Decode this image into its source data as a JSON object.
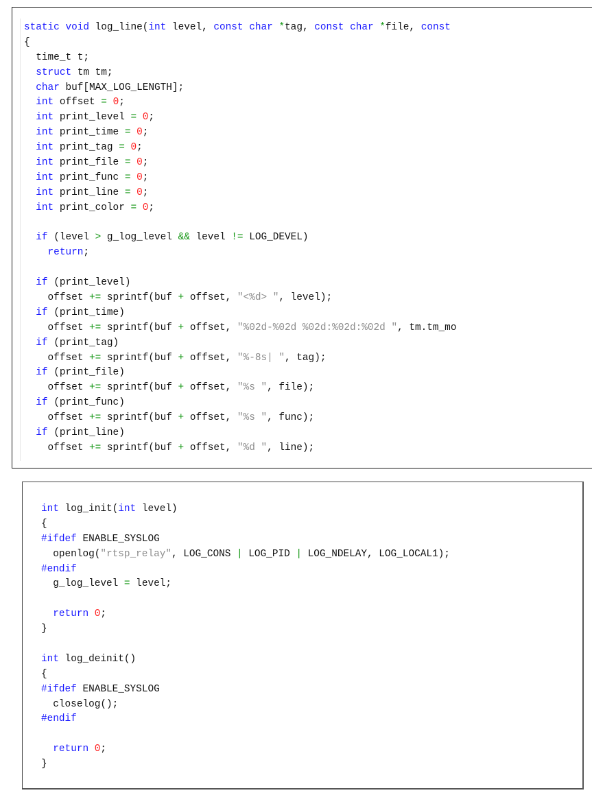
{
  "panels": [
    {
      "name": "log-line-function",
      "lines": [
        [
          [
            "kw",
            "static"
          ],
          [
            "plain",
            " "
          ],
          [
            "kw",
            "void"
          ],
          [
            "plain",
            " log_line("
          ],
          [
            "kw",
            "int"
          ],
          [
            "plain",
            " level, "
          ],
          [
            "kw",
            "const"
          ],
          [
            "plain",
            " "
          ],
          [
            "kw",
            "char"
          ],
          [
            "plain",
            " "
          ],
          [
            "op",
            "*"
          ],
          [
            "plain",
            "tag, "
          ],
          [
            "kw",
            "const"
          ],
          [
            "plain",
            " "
          ],
          [
            "kw",
            "char"
          ],
          [
            "plain",
            " "
          ],
          [
            "op",
            "*"
          ],
          [
            "plain",
            "file, "
          ],
          [
            "kw",
            "const"
          ]
        ],
        [
          [
            "plain",
            "{"
          ]
        ],
        [
          [
            "plain",
            "  time_t t;"
          ]
        ],
        [
          [
            "plain",
            "  "
          ],
          [
            "kw",
            "struct"
          ],
          [
            "plain",
            " tm tm;"
          ]
        ],
        [
          [
            "plain",
            "  "
          ],
          [
            "kw",
            "char"
          ],
          [
            "plain",
            " buf[MAX_LOG_LENGTH];"
          ]
        ],
        [
          [
            "plain",
            "  "
          ],
          [
            "kw",
            "int"
          ],
          [
            "plain",
            " offset "
          ],
          [
            "op",
            "="
          ],
          [
            "plain",
            " "
          ],
          [
            "num",
            "0"
          ],
          [
            "plain",
            ";"
          ]
        ],
        [
          [
            "plain",
            "  "
          ],
          [
            "kw",
            "int"
          ],
          [
            "plain",
            " print_level "
          ],
          [
            "op",
            "="
          ],
          [
            "plain",
            " "
          ],
          [
            "num",
            "0"
          ],
          [
            "plain",
            ";"
          ]
        ],
        [
          [
            "plain",
            "  "
          ],
          [
            "kw",
            "int"
          ],
          [
            "plain",
            " print_time "
          ],
          [
            "op",
            "="
          ],
          [
            "plain",
            " "
          ],
          [
            "num",
            "0"
          ],
          [
            "plain",
            ";"
          ]
        ],
        [
          [
            "plain",
            "  "
          ],
          [
            "kw",
            "int"
          ],
          [
            "plain",
            " print_tag "
          ],
          [
            "op",
            "="
          ],
          [
            "plain",
            " "
          ],
          [
            "num",
            "0"
          ],
          [
            "plain",
            ";"
          ]
        ],
        [
          [
            "plain",
            "  "
          ],
          [
            "kw",
            "int"
          ],
          [
            "plain",
            " print_file "
          ],
          [
            "op",
            "="
          ],
          [
            "plain",
            " "
          ],
          [
            "num",
            "0"
          ],
          [
            "plain",
            ";"
          ]
        ],
        [
          [
            "plain",
            "  "
          ],
          [
            "kw",
            "int"
          ],
          [
            "plain",
            " print_func "
          ],
          [
            "op",
            "="
          ],
          [
            "plain",
            " "
          ],
          [
            "num",
            "0"
          ],
          [
            "plain",
            ";"
          ]
        ],
        [
          [
            "plain",
            "  "
          ],
          [
            "kw",
            "int"
          ],
          [
            "plain",
            " print_line "
          ],
          [
            "op",
            "="
          ],
          [
            "plain",
            " "
          ],
          [
            "num",
            "0"
          ],
          [
            "plain",
            ";"
          ]
        ],
        [
          [
            "plain",
            "  "
          ],
          [
            "kw",
            "int"
          ],
          [
            "plain",
            " print_color "
          ],
          [
            "op",
            "="
          ],
          [
            "plain",
            " "
          ],
          [
            "num",
            "0"
          ],
          [
            "plain",
            ";"
          ]
        ],
        [
          [
            "plain",
            ""
          ]
        ],
        [
          [
            "plain",
            "  "
          ],
          [
            "kw",
            "if"
          ],
          [
            "plain",
            " (level "
          ],
          [
            "op",
            ">"
          ],
          [
            "plain",
            " g_log_level "
          ],
          [
            "op",
            "&&"
          ],
          [
            "plain",
            " level "
          ],
          [
            "op",
            "!="
          ],
          [
            "plain",
            " LOG_DEVEL)"
          ]
        ],
        [
          [
            "plain",
            "    "
          ],
          [
            "kw",
            "return"
          ],
          [
            "plain",
            ";"
          ]
        ],
        [
          [
            "plain",
            ""
          ]
        ],
        [
          [
            "plain",
            "  "
          ],
          [
            "kw",
            "if"
          ],
          [
            "plain",
            " (print_level)"
          ]
        ],
        [
          [
            "plain",
            "    offset "
          ],
          [
            "op",
            "+="
          ],
          [
            "plain",
            " sprintf(buf "
          ],
          [
            "op",
            "+"
          ],
          [
            "plain",
            " offset, "
          ],
          [
            "str",
            "\"<%d> \""
          ],
          [
            "plain",
            ", level);"
          ]
        ],
        [
          [
            "plain",
            "  "
          ],
          [
            "kw",
            "if"
          ],
          [
            "plain",
            " (print_time)"
          ]
        ],
        [
          [
            "plain",
            "    offset "
          ],
          [
            "op",
            "+="
          ],
          [
            "plain",
            " sprintf(buf "
          ],
          [
            "op",
            "+"
          ],
          [
            "plain",
            " offset, "
          ],
          [
            "str",
            "\"%02d-%02d %02d:%02d:%02d \""
          ],
          [
            "plain",
            ", tm.tm_mo"
          ]
        ],
        [
          [
            "plain",
            "  "
          ],
          [
            "kw",
            "if"
          ],
          [
            "plain",
            " (print_tag)"
          ]
        ],
        [
          [
            "plain",
            "    offset "
          ],
          [
            "op",
            "+="
          ],
          [
            "plain",
            " sprintf(buf "
          ],
          [
            "op",
            "+"
          ],
          [
            "plain",
            " offset, "
          ],
          [
            "str",
            "\"%-8s| \""
          ],
          [
            "plain",
            ", tag);"
          ]
        ],
        [
          [
            "plain",
            "  "
          ],
          [
            "kw",
            "if"
          ],
          [
            "plain",
            " (print_file)"
          ]
        ],
        [
          [
            "plain",
            "    offset "
          ],
          [
            "op",
            "+="
          ],
          [
            "plain",
            " sprintf(buf "
          ],
          [
            "op",
            "+"
          ],
          [
            "plain",
            " offset, "
          ],
          [
            "str",
            "\"%s \""
          ],
          [
            "plain",
            ", file);"
          ]
        ],
        [
          [
            "plain",
            "  "
          ],
          [
            "kw",
            "if"
          ],
          [
            "plain",
            " (print_func)"
          ]
        ],
        [
          [
            "plain",
            "    offset "
          ],
          [
            "op",
            "+="
          ],
          [
            "plain",
            " sprintf(buf "
          ],
          [
            "op",
            "+"
          ],
          [
            "plain",
            " offset, "
          ],
          [
            "str",
            "\"%s \""
          ],
          [
            "plain",
            ", func);"
          ]
        ],
        [
          [
            "plain",
            "  "
          ],
          [
            "kw",
            "if"
          ],
          [
            "plain",
            " (print_line)"
          ]
        ],
        [
          [
            "plain",
            "    offset "
          ],
          [
            "op",
            "+="
          ],
          [
            "plain",
            " sprintf(buf "
          ],
          [
            "op",
            "+"
          ],
          [
            "plain",
            " offset, "
          ],
          [
            "str",
            "\"%d \""
          ],
          [
            "plain",
            ", line);"
          ]
        ]
      ]
    },
    {
      "name": "log-init-deinit-functions",
      "lines": [
        [
          [
            "kw",
            "int"
          ],
          [
            "plain",
            " log_init("
          ],
          [
            "kw",
            "int"
          ],
          [
            "plain",
            " level)"
          ]
        ],
        [
          [
            "plain",
            "{"
          ]
        ],
        [
          [
            "pp",
            "#ifdef"
          ],
          [
            "plain",
            " ENABLE_SYSLOG"
          ]
        ],
        [
          [
            "plain",
            "  openlog("
          ],
          [
            "str",
            "\"rtsp_relay\""
          ],
          [
            "plain",
            ", LOG_CONS "
          ],
          [
            "op",
            "|"
          ],
          [
            "plain",
            " LOG_PID "
          ],
          [
            "op",
            "|"
          ],
          [
            "plain",
            " LOG_NDELAY, LOG_LOCAL1);"
          ]
        ],
        [
          [
            "pp",
            "#endif"
          ]
        ],
        [
          [
            "plain",
            "  g_log_level "
          ],
          [
            "op",
            "="
          ],
          [
            "plain",
            " level;"
          ]
        ],
        [
          [
            "plain",
            ""
          ]
        ],
        [
          [
            "plain",
            "  "
          ],
          [
            "kw",
            "return"
          ],
          [
            "plain",
            " "
          ],
          [
            "num",
            "0"
          ],
          [
            "plain",
            ";"
          ]
        ],
        [
          [
            "plain",
            "}"
          ]
        ],
        [
          [
            "plain",
            ""
          ]
        ],
        [
          [
            "kw",
            "int"
          ],
          [
            "plain",
            " log_deinit()"
          ]
        ],
        [
          [
            "plain",
            "{"
          ]
        ],
        [
          [
            "pp",
            "#ifdef"
          ],
          [
            "plain",
            " ENABLE_SYSLOG"
          ]
        ],
        [
          [
            "plain",
            "  closelog();"
          ]
        ],
        [
          [
            "pp",
            "#endif"
          ]
        ],
        [
          [
            "plain",
            ""
          ]
        ],
        [
          [
            "plain",
            "  "
          ],
          [
            "kw",
            "return"
          ],
          [
            "plain",
            " "
          ],
          [
            "num",
            "0"
          ],
          [
            "plain",
            ";"
          ]
        ],
        [
          [
            "plain",
            "}"
          ]
        ]
      ]
    }
  ],
  "colors": {
    "keyword": "#1a1aff",
    "operator": "#129612",
    "number": "#ff2020",
    "string": "#8c8c8c",
    "text": "#111111"
  }
}
